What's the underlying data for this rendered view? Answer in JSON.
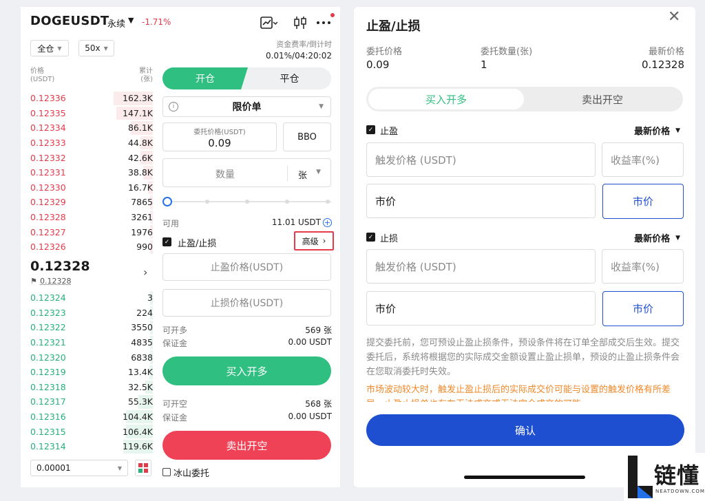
{
  "header": {
    "symbol": "DOGEUSDT",
    "perpetual": "永续",
    "change": "-1.71%",
    "icons": [
      "chart-settings-icon",
      "candlestick-icon",
      "more-icon"
    ]
  },
  "controls": {
    "margin_mode": "全仓",
    "leverage": "50x",
    "funding_label": "资金费率/倒计时",
    "funding_value": "0.01%/04:20:02"
  },
  "orderbook": {
    "price_header": "价格",
    "price_unit": "(USDT)",
    "qty_header": "累计",
    "qty_unit": "(张)",
    "asks": [
      {
        "price": "0.12336",
        "qty": "162.3K",
        "depth": 0.16
      },
      {
        "price": "0.12335",
        "qty": "147.1K",
        "depth": 0.15
      },
      {
        "price": "0.12334",
        "qty": "86.1K",
        "depth": 0.09
      },
      {
        "price": "0.12333",
        "qty": "44.8K",
        "depth": 0.05
      },
      {
        "price": "0.12332",
        "qty": "42.6K",
        "depth": 0.05
      },
      {
        "price": "0.12331",
        "qty": "38.8K",
        "depth": 0.04
      },
      {
        "price": "0.12330",
        "qty": "16.7K",
        "depth": 0.02
      },
      {
        "price": "0.12329",
        "qty": "7865",
        "depth": 0.01
      },
      {
        "price": "0.12328",
        "qty": "3261",
        "depth": 0.005
      },
      {
        "price": "0.12327",
        "qty": "1976",
        "depth": 0.003
      },
      {
        "price": "0.12326",
        "qty": "990",
        "depth": 0.002
      }
    ],
    "last_price": "0.12328",
    "mark_price": "0.12328",
    "bids": [
      {
        "price": "0.12324",
        "qty": "3",
        "depth": 0.001
      },
      {
        "price": "0.12323",
        "qty": "224",
        "depth": 0.002
      },
      {
        "price": "0.12322",
        "qty": "3550",
        "depth": 0.005
      },
      {
        "price": "0.12321",
        "qty": "4835",
        "depth": 0.006
      },
      {
        "price": "0.12320",
        "qty": "6838",
        "depth": 0.008
      },
      {
        "price": "0.12319",
        "qty": "13.4K",
        "depth": 0.015
      },
      {
        "price": "0.12318",
        "qty": "32.5K",
        "depth": 0.03
      },
      {
        "price": "0.12317",
        "qty": "55.3K",
        "depth": 0.06
      },
      {
        "price": "0.12316",
        "qty": "104.4K",
        "depth": 0.11
      },
      {
        "price": "0.12315",
        "qty": "106.4K",
        "depth": 0.11
      },
      {
        "price": "0.12314",
        "qty": "119.6K",
        "depth": 0.12
      }
    ],
    "precision": "0.00001"
  },
  "order_form": {
    "tab_open": "开仓",
    "tab_close": "平仓",
    "order_type": "限价单",
    "price_label": "委托价格(USDT)",
    "price_value": "0.09",
    "bbo_label": "BBO",
    "qty_placeholder": "数量",
    "qty_unit": "张",
    "slider_percent": 0,
    "available_label": "可用",
    "available_value": "11.01 USDT",
    "tpsl_label": "止盈/止损",
    "tpsl_checked": true,
    "advanced_label": "高级",
    "tp_placeholder": "止盈价格(USDT)",
    "sl_placeholder": "止损价格(USDT)",
    "long_open_label": "可开多",
    "long_open_value": "569 张",
    "long_margin_label": "保证金",
    "long_margin_value": "0.00 USDT",
    "buy_button": "买入开多",
    "short_open_label": "可开空",
    "short_open_value": "568 张",
    "short_margin_label": "保证金",
    "short_margin_value": "0.00 USDT",
    "sell_button": "卖出开空",
    "iceberg_label": "冰山委托"
  },
  "tpsl_sheet": {
    "title": "止盈/止损",
    "order_price_label": "委托价格",
    "order_price_value": "0.09",
    "order_qty_label": "委托数量(张)",
    "order_qty_value": "1",
    "last_price_label": "最新价格",
    "last_price_value": "0.12328",
    "seg_buy": "买入开多",
    "seg_sell": "卖出开空",
    "tp_label": "止盈",
    "tp_trigger_type": "最新价格",
    "tp_trigger_placeholder": "触发价格 (USDT)",
    "tp_roe_placeholder": "收益率(%)",
    "tp_exec_value": "市价",
    "tp_market_button": "市价",
    "sl_label": "止损",
    "sl_trigger_type": "最新价格",
    "sl_trigger_placeholder": "触发价格 (USDT)",
    "sl_roe_placeholder": "收益率(%)",
    "sl_exec_value": "市价",
    "sl_market_button": "市价",
    "note": "提交委托前，您可预设止盈止损条件，预设条件将在订单全部成交后生效。提交委托后，系统将根据您的实际成交金额设置止盈止损单，预设的止盈止损条件会在您取消委托时失效。",
    "warning": "市场波动较大时，触发止盈止损后的实际成交价可能与设置的触发价格有所差异，止盈止损单也存在无法成交或无法完全成交的可能。",
    "confirm_button": "确认"
  },
  "watermark": {
    "brand": "链懂",
    "domain": "NEATDOWN.COM"
  },
  "colors": {
    "green": "#2fbf81",
    "red": "#e6394a",
    "blue": "#1f4fd1",
    "orange": "#f0892a"
  }
}
